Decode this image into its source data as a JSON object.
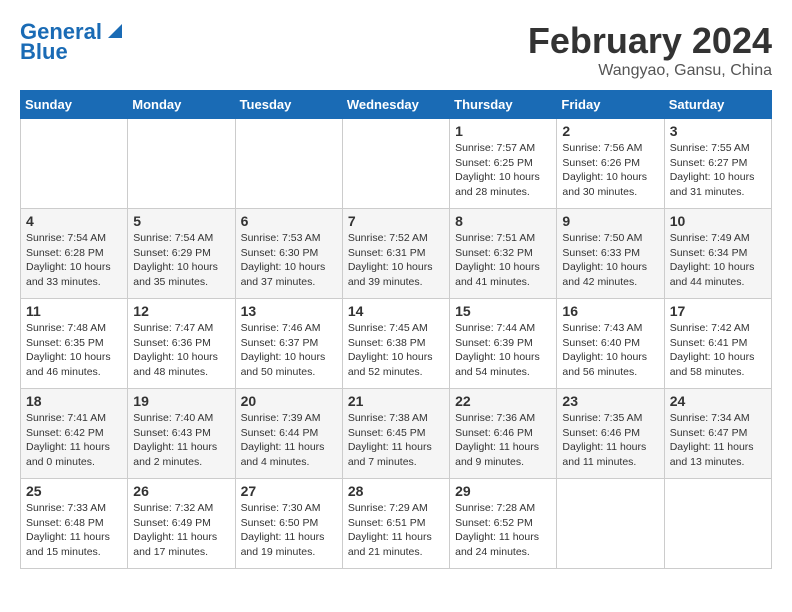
{
  "header": {
    "logo_line1": "General",
    "logo_line2": "Blue",
    "month_year": "February 2024",
    "location": "Wangyao, Gansu, China"
  },
  "days_of_week": [
    "Sunday",
    "Monday",
    "Tuesday",
    "Wednesday",
    "Thursday",
    "Friday",
    "Saturday"
  ],
  "weeks": [
    [
      {
        "day": "",
        "info": ""
      },
      {
        "day": "",
        "info": ""
      },
      {
        "day": "",
        "info": ""
      },
      {
        "day": "",
        "info": ""
      },
      {
        "day": "1",
        "info": "Sunrise: 7:57 AM\nSunset: 6:25 PM\nDaylight: 10 hours\nand 28 minutes."
      },
      {
        "day": "2",
        "info": "Sunrise: 7:56 AM\nSunset: 6:26 PM\nDaylight: 10 hours\nand 30 minutes."
      },
      {
        "day": "3",
        "info": "Sunrise: 7:55 AM\nSunset: 6:27 PM\nDaylight: 10 hours\nand 31 minutes."
      }
    ],
    [
      {
        "day": "4",
        "info": "Sunrise: 7:54 AM\nSunset: 6:28 PM\nDaylight: 10 hours\nand 33 minutes."
      },
      {
        "day": "5",
        "info": "Sunrise: 7:54 AM\nSunset: 6:29 PM\nDaylight: 10 hours\nand 35 minutes."
      },
      {
        "day": "6",
        "info": "Sunrise: 7:53 AM\nSunset: 6:30 PM\nDaylight: 10 hours\nand 37 minutes."
      },
      {
        "day": "7",
        "info": "Sunrise: 7:52 AM\nSunset: 6:31 PM\nDaylight: 10 hours\nand 39 minutes."
      },
      {
        "day": "8",
        "info": "Sunrise: 7:51 AM\nSunset: 6:32 PM\nDaylight: 10 hours\nand 41 minutes."
      },
      {
        "day": "9",
        "info": "Sunrise: 7:50 AM\nSunset: 6:33 PM\nDaylight: 10 hours\nand 42 minutes."
      },
      {
        "day": "10",
        "info": "Sunrise: 7:49 AM\nSunset: 6:34 PM\nDaylight: 10 hours\nand 44 minutes."
      }
    ],
    [
      {
        "day": "11",
        "info": "Sunrise: 7:48 AM\nSunset: 6:35 PM\nDaylight: 10 hours\nand 46 minutes."
      },
      {
        "day": "12",
        "info": "Sunrise: 7:47 AM\nSunset: 6:36 PM\nDaylight: 10 hours\nand 48 minutes."
      },
      {
        "day": "13",
        "info": "Sunrise: 7:46 AM\nSunset: 6:37 PM\nDaylight: 10 hours\nand 50 minutes."
      },
      {
        "day": "14",
        "info": "Sunrise: 7:45 AM\nSunset: 6:38 PM\nDaylight: 10 hours\nand 52 minutes."
      },
      {
        "day": "15",
        "info": "Sunrise: 7:44 AM\nSunset: 6:39 PM\nDaylight: 10 hours\nand 54 minutes."
      },
      {
        "day": "16",
        "info": "Sunrise: 7:43 AM\nSunset: 6:40 PM\nDaylight: 10 hours\nand 56 minutes."
      },
      {
        "day": "17",
        "info": "Sunrise: 7:42 AM\nSunset: 6:41 PM\nDaylight: 10 hours\nand 58 minutes."
      }
    ],
    [
      {
        "day": "18",
        "info": "Sunrise: 7:41 AM\nSunset: 6:42 PM\nDaylight: 11 hours\nand 0 minutes."
      },
      {
        "day": "19",
        "info": "Sunrise: 7:40 AM\nSunset: 6:43 PM\nDaylight: 11 hours\nand 2 minutes."
      },
      {
        "day": "20",
        "info": "Sunrise: 7:39 AM\nSunset: 6:44 PM\nDaylight: 11 hours\nand 4 minutes."
      },
      {
        "day": "21",
        "info": "Sunrise: 7:38 AM\nSunset: 6:45 PM\nDaylight: 11 hours\nand 7 minutes."
      },
      {
        "day": "22",
        "info": "Sunrise: 7:36 AM\nSunset: 6:46 PM\nDaylight: 11 hours\nand 9 minutes."
      },
      {
        "day": "23",
        "info": "Sunrise: 7:35 AM\nSunset: 6:46 PM\nDaylight: 11 hours\nand 11 minutes."
      },
      {
        "day": "24",
        "info": "Sunrise: 7:34 AM\nSunset: 6:47 PM\nDaylight: 11 hours\nand 13 minutes."
      }
    ],
    [
      {
        "day": "25",
        "info": "Sunrise: 7:33 AM\nSunset: 6:48 PM\nDaylight: 11 hours\nand 15 minutes."
      },
      {
        "day": "26",
        "info": "Sunrise: 7:32 AM\nSunset: 6:49 PM\nDaylight: 11 hours\nand 17 minutes."
      },
      {
        "day": "27",
        "info": "Sunrise: 7:30 AM\nSunset: 6:50 PM\nDaylight: 11 hours\nand 19 minutes."
      },
      {
        "day": "28",
        "info": "Sunrise: 7:29 AM\nSunset: 6:51 PM\nDaylight: 11 hours\nand 21 minutes."
      },
      {
        "day": "29",
        "info": "Sunrise: 7:28 AM\nSunset: 6:52 PM\nDaylight: 11 hours\nand 24 minutes."
      },
      {
        "day": "",
        "info": ""
      },
      {
        "day": "",
        "info": ""
      }
    ]
  ]
}
